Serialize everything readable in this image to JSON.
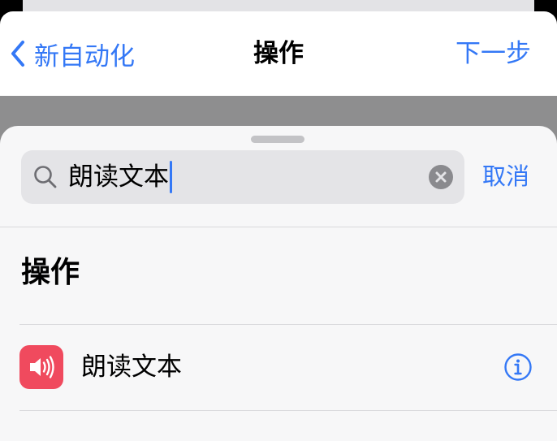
{
  "nav": {
    "back_label": "新自动化",
    "title": "操作",
    "next_label": "下一步"
  },
  "search": {
    "value": "朗读文本",
    "cancel_label": "取消"
  },
  "section": {
    "heading": "操作"
  },
  "results": [
    {
      "label": "朗读文本",
      "icon": "speaker-icon",
      "icon_color": "#f04a5e"
    }
  ],
  "colors": {
    "accent": "#3478f6",
    "sheet_background": "#f7f7f8",
    "search_field": "#e4e4e7"
  }
}
